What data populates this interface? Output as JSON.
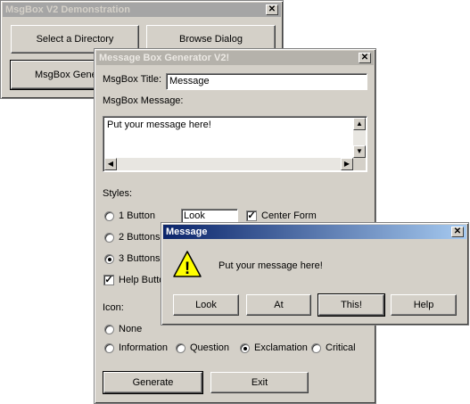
{
  "demo_window": {
    "title": "MsgBox V2 Demonstration",
    "close_glyph": "✕",
    "buttons": [
      "Select a Directory",
      "Browse Dialog",
      "MsgBox Generator"
    ]
  },
  "generator": {
    "title": "Message Box Generator V2!",
    "close_glyph": "✕",
    "title_label": "MsgBox Title:",
    "title_value": "Message",
    "message_label": "MsgBox Message:",
    "message_value": "Put your message here!",
    "styles_label": "Styles:",
    "styles": [
      {
        "label": "1 Button",
        "selected": false
      },
      {
        "label": "2 Buttons",
        "selected": false
      },
      {
        "label": "3 Buttons",
        "selected": true
      }
    ],
    "help_button_label": "Help Button",
    "help_button_checked": true,
    "look_field_value": "Look",
    "center_form_label": "Center Form",
    "center_form_checked": true,
    "icon_label": "Icon:",
    "icons": [
      {
        "label": "None",
        "selected": false
      },
      {
        "label": "Information",
        "selected": false
      },
      {
        "label": "Question",
        "selected": false
      },
      {
        "label": "Exclamation",
        "selected": true
      },
      {
        "label": "Critical",
        "selected": false
      }
    ],
    "generate_label": "Generate",
    "exit_label": "Exit"
  },
  "message_box": {
    "title": "Message",
    "close_glyph": "✕",
    "text": "Put your message here!",
    "icon_glyph": "!",
    "buttons": [
      "Look",
      "At",
      "This!",
      "Help"
    ]
  },
  "colors": {
    "face": "#d4d0c8",
    "active_title_start": "#0a246a",
    "active_title_end": "#a6caf0",
    "inactive_title": "#a5a5a5",
    "warning_yellow": "#ffff00"
  },
  "icons_used": [
    "close-icon",
    "exclamation-icon",
    "scroll-up-icon",
    "scroll-down-icon",
    "scroll-left-icon",
    "scroll-right-icon"
  ]
}
